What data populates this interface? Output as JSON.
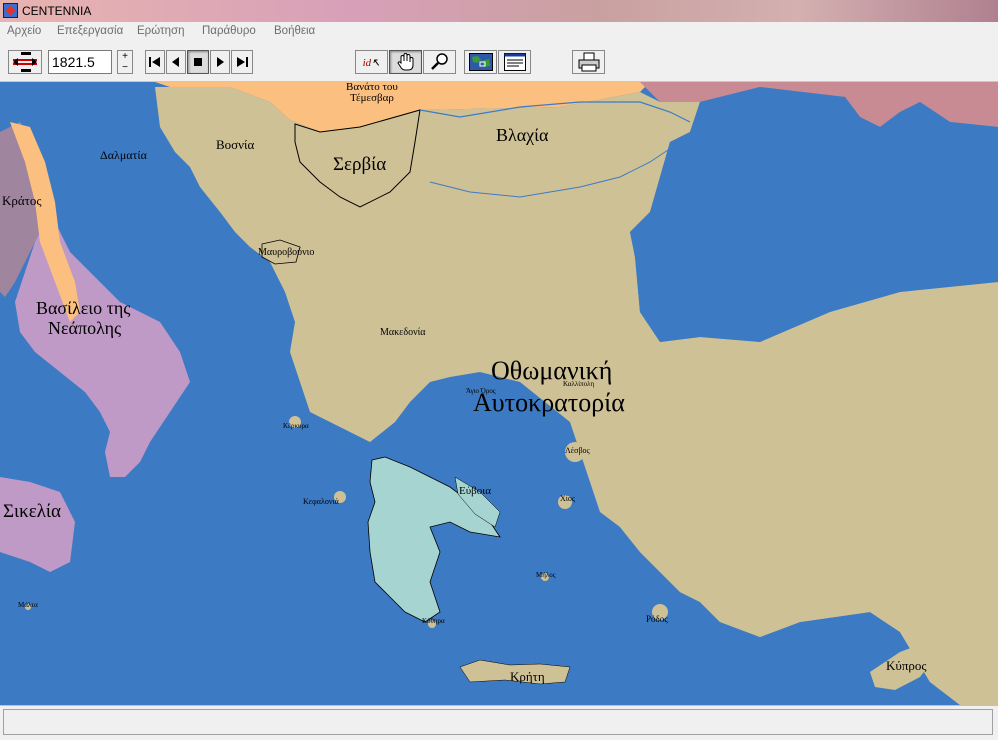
{
  "window": {
    "title": "CENTENNIA"
  },
  "menu": [
    {
      "label": "Αρχείο"
    },
    {
      "label": "Επεξεργασία"
    },
    {
      "label": "Ερώτηση"
    },
    {
      "label": "Παράθυρο"
    },
    {
      "label": "Βοήθεια"
    }
  ],
  "toolbar": {
    "year": "1821.5",
    "spin_up": "+",
    "spin_down": "−",
    "id_label": "id",
    "icons": [
      "year-range-icon",
      "skip-back-icon",
      "step-back-icon",
      "stop-icon",
      "step-forward-icon",
      "skip-forward-icon",
      "identify-icon",
      "hand-pan-icon",
      "zoom-icon",
      "overview-map-icon",
      "text-panel-icon",
      "print-icon"
    ]
  },
  "map": {
    "colors": {
      "sea": "#3c7bc4",
      "ottoman": "#cfc196",
      "greece": "#a6d4d0",
      "naples": "#c09ac6",
      "austria": "#fbbf7f",
      "papal": "#a0859e",
      "russia": "#c98b93"
    },
    "labels": {
      "banat": "Βανάτο του Τέμεσβαρ",
      "vlachia": "Βλαχία",
      "dalmatia": "Δαλματία",
      "bosnia": "Βοσνία",
      "serbia": "Σερβία",
      "kratos": "Κράτος",
      "montenegro": "Μαυροβούνιο",
      "naples_1": "Βασίλειο της",
      "naples_2": "Νεάπολης",
      "macedonia": "Μακεδονία",
      "ottoman_1": "Οθωμανική",
      "ottoman_2": "Αυτοκρατορία",
      "athos": "Άγιο Όρος",
      "kallipoli": "Καλλίπολη",
      "kerkyra": "Κέρκυρα",
      "lesvos": "Λέσβος",
      "sicily": "Σικελία",
      "evia": "Εύβοια",
      "kefalonia": "Κεφαλονιά",
      "chios": "Χίος",
      "milos": "Μήλος",
      "malta": "Μάλτα",
      "kythira": "Κύθηρα",
      "rodos": "Ρόδος",
      "kyprus": "Κύπρος",
      "kriti": "Κρήτη"
    }
  }
}
